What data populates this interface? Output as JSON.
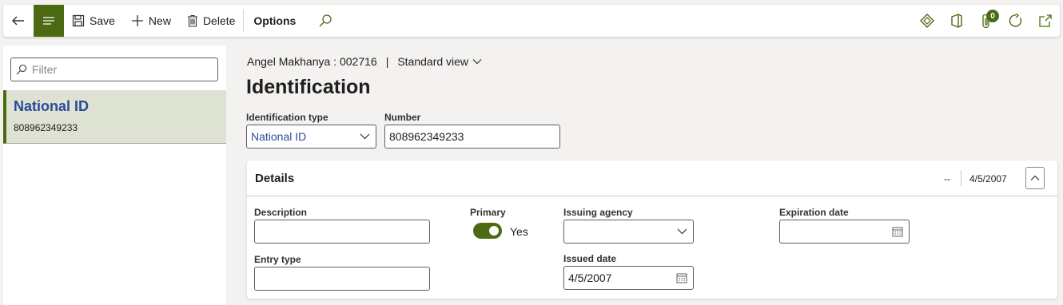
{
  "toolbar": {
    "save_label": "Save",
    "new_label": "New",
    "delete_label": "Delete",
    "options_label": "Options",
    "attachments_count": "0",
    "accent_color": "#4b6a11"
  },
  "left_pane": {
    "filter_placeholder": "Filter",
    "items": [
      {
        "title": "National ID",
        "subtitle": "808962349233"
      }
    ]
  },
  "header": {
    "record": "Angel Makhanya : 002716",
    "separator": "|",
    "view_label": "Standard view",
    "page_title": "Identification"
  },
  "form": {
    "identification_type_label": "Identification type",
    "identification_type_value": "National ID",
    "number_label": "Number",
    "number_value": "808962349233"
  },
  "details": {
    "title": "Details",
    "summary_1": "--",
    "summary_2": "4/5/2007",
    "description_label": "Description",
    "description_value": "",
    "entry_type_label": "Entry type",
    "entry_type_value": "",
    "primary_label": "Primary",
    "primary_value": "Yes",
    "primary_on": true,
    "issuing_agency_label": "Issuing agency",
    "issuing_agency_value": "",
    "issued_date_label": "Issued date",
    "issued_date_value": "4/5/2007",
    "expiration_date_label": "Expiration date",
    "expiration_date_value": ""
  }
}
